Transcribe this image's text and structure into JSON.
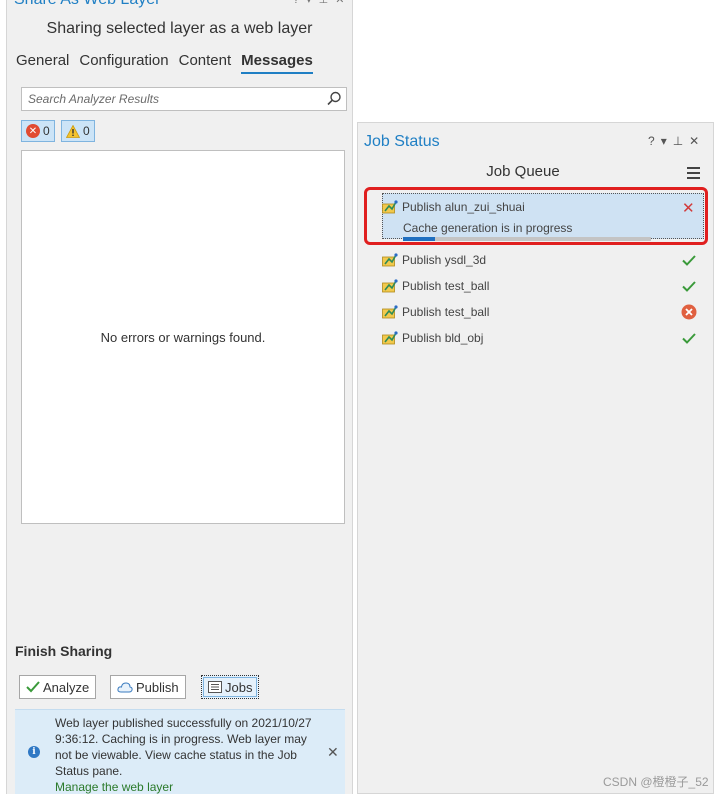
{
  "share_pane": {
    "title": "Share As Web Layer",
    "subtitle": "Sharing selected layer as a web layer",
    "tabs": [
      {
        "label": "General"
      },
      {
        "label": "Configuration"
      },
      {
        "label": "Content"
      },
      {
        "label": "Messages",
        "active": true
      }
    ],
    "search": {
      "placeholder": "Search Analyzer Results",
      "value": ""
    },
    "error_count": "0",
    "warning_count": "0",
    "empty_message": "No errors or warnings found.",
    "finish_title": "Finish Sharing",
    "buttons": {
      "analyze": "Analyze",
      "publish": "Publish",
      "jobs": "Jobs"
    },
    "info": {
      "message": "Web layer published successfully on 2021/10/27 9:36:12. Caching is in progress. Web layer may not be viewable. View cache status in the Job Status pane.",
      "link": "Manage the web layer"
    }
  },
  "job_pane": {
    "title": "Job Status",
    "controls": [
      "?",
      "▾",
      "⊥",
      "✕"
    ],
    "queue_title": "Job Queue",
    "jobs": [
      {
        "label": "Publish alun_zui_shuai",
        "status": "in-progress",
        "detail": "Cache generation is in progress",
        "progress": 0.13
      },
      {
        "label": "Publish ysdl_3d",
        "status": "success"
      },
      {
        "label": "Publish test_ball",
        "status": "success"
      },
      {
        "label": "Publish test_ball",
        "status": "failed"
      },
      {
        "label": "Publish bld_obj",
        "status": "success"
      }
    ]
  },
  "colors": {
    "accent": "#1f7fc4",
    "success": "#3a9a3a",
    "error": "#e14b32",
    "highlight": "#e01f1f",
    "progress": "#1f6fc0"
  },
  "watermark": "CSDN @橙橙子_52"
}
